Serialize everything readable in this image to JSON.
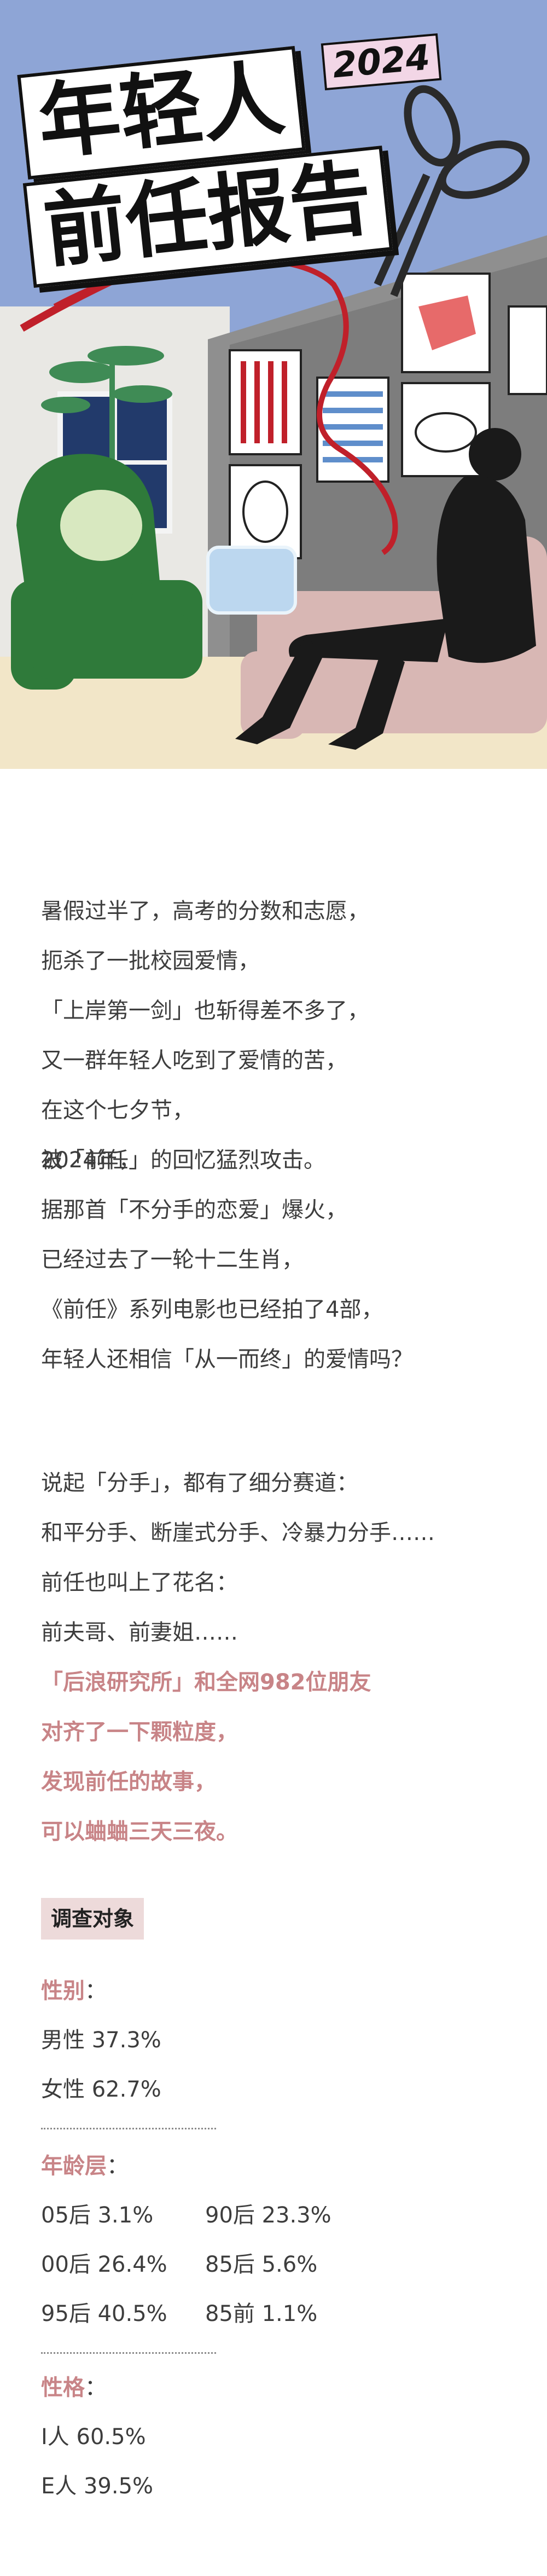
{
  "hero": {
    "title_line1": "年轻人",
    "title_line2": "前任报告",
    "badge": "2024",
    "colors": {
      "sky": "#8ea5d6",
      "wall": "#8f8f8f",
      "wall_light": "#e7e7e7",
      "sofa": "#d8b7b4",
      "silhouette": "#1a1a1a",
      "ribbon": "#c0202a",
      "plant": "#3f8b55",
      "green_chair": "#2f7a3a",
      "floor": "#f2e6c8"
    },
    "icons": [
      "scissors-icon",
      "ribbon-icon"
    ]
  },
  "intro": {
    "p1": [
      "暑假过半了，高考的分数和志愿，",
      "扼杀了一批校园爱情，",
      "「上岸第一剑」也斩得差不多了，",
      "又一群年轻人吃到了爱情的苦，",
      "在这个七夕节，",
      "被「前任」的回忆猛烈攻击。"
    ],
    "p2": [
      "2024年，",
      "据那首「不分手的恋爱」爆火，",
      "已经过去了一轮十二生肖，",
      "《前任》系列电影也已经拍了4部，",
      "年轻人还相信「从一而终」的爱情吗？"
    ],
    "p3": [
      "说起「分手」，都有了细分赛道：",
      "和平分手、断崖式分手、冷暴力分手……",
      "前任也叫上了花名：",
      "前夫哥、前妻姐……"
    ],
    "p4_highlight": [
      "「后浪研究所」和全网982位朋友",
      "对齐了一下颗粒度，",
      "发现前任的故事，",
      "可以蛐蛐三天三夜。"
    ]
  },
  "survey": {
    "tag": "调查对象",
    "gender": {
      "label": "性别",
      "colon": "：",
      "items": [
        "男性 37.3%",
        "女性 62.7%"
      ]
    },
    "age": {
      "label": "年龄层",
      "colon": "：",
      "rows": [
        [
          "05后 3.1%",
          "90后 23.3%"
        ],
        [
          "00后 26.4%",
          "85后 5.6%"
        ],
        [
          "95后 40.5%",
          "85前 1.1%"
        ]
      ]
    },
    "personality": {
      "label": "性格",
      "colon": "：",
      "items": [
        "I人 60.5%",
        "E人 39.5%"
      ]
    }
  }
}
